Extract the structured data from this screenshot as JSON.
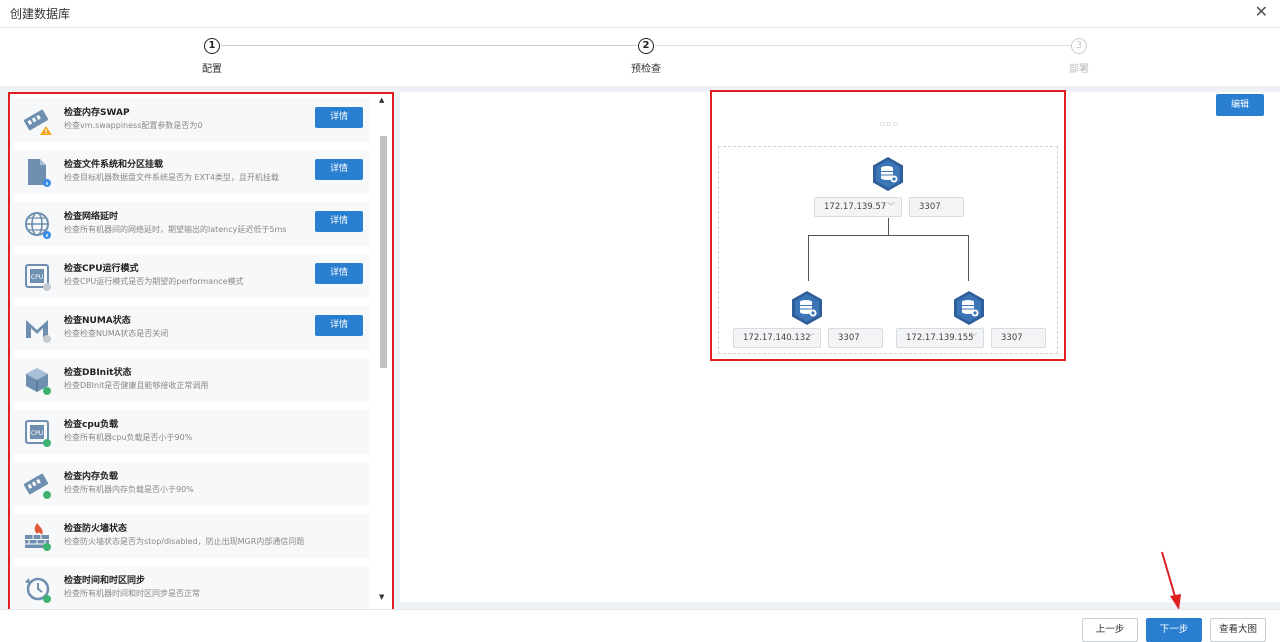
{
  "window": {
    "title": "创建数据库"
  },
  "steps": [
    {
      "num": "1",
      "label": "配置",
      "state": "done"
    },
    {
      "num": "2",
      "label": "预检查",
      "state": "active"
    },
    {
      "num": "3",
      "label": "部署",
      "state": "disabled"
    }
  ],
  "checks": [
    {
      "title": "检查内存SWAP",
      "desc": "检查vm.swappiness配置参数是否为0",
      "icon": "memory-icon",
      "status": "warning",
      "button": "详情"
    },
    {
      "title": "检查文件系统和分区挂载",
      "desc": "检查目标机器数据盘文件系统是否为 EXT4类型，且开机挂载",
      "icon": "file-icon",
      "status": "info",
      "button": "详情"
    },
    {
      "title": "检查网络延时",
      "desc": "检查所有机器间的网络延时，期望输出的latency延迟低于5ms",
      "icon": "globe-icon",
      "status": "info",
      "button": "详情"
    },
    {
      "title": "检查CPU运行模式",
      "desc": "检查CPU运行模式是否为期望的performance模式",
      "icon": "cpu-icon",
      "status": "pending",
      "button": "详情"
    },
    {
      "title": "检查NUMA状态",
      "desc": "检查检查NUMA状态是否关闭",
      "icon": "numa-icon",
      "status": "pending",
      "button": "详情"
    },
    {
      "title": "检查DBInit状态",
      "desc": "检查DBInit是否健康且能够接收正常调用",
      "icon": "cube-icon",
      "status": "ok",
      "button": ""
    },
    {
      "title": "检查cpu负载",
      "desc": "检查所有机器cpu负载是否小于90%",
      "icon": "cpu-icon",
      "status": "ok",
      "button": ""
    },
    {
      "title": "检查内存负载",
      "desc": "检查所有机器内存负载是否小于90%",
      "icon": "memory-icon",
      "status": "ok",
      "button": ""
    },
    {
      "title": "检查防火墙状态",
      "desc": "检查防火墙状态是否为stop/disabled，防止出现MGR内部通信问题",
      "icon": "firewall-icon",
      "status": "ok",
      "button": ""
    },
    {
      "title": "检查时间和时区同步",
      "desc": "检查所有机器时间和时区同步是否正常",
      "icon": "clock-icon",
      "status": "ok",
      "button": ""
    }
  ],
  "topology": {
    "edit_label": "编辑",
    "primary": {
      "ip": "172.17.139.57",
      "port": "3307"
    },
    "replicas": [
      {
        "ip": "172.17.140.132",
        "port": "3307"
      },
      {
        "ip": "172.17.139.155",
        "port": "3307"
      }
    ]
  },
  "footer": {
    "prev": "上一步",
    "next": "下一步",
    "view": "查看大图"
  },
  "colors": {
    "accent": "#2b7fd1",
    "highlight": "#e02020",
    "ok": "#3cb371",
    "warning": "#f5a623",
    "info": "#3a8ee6"
  }
}
